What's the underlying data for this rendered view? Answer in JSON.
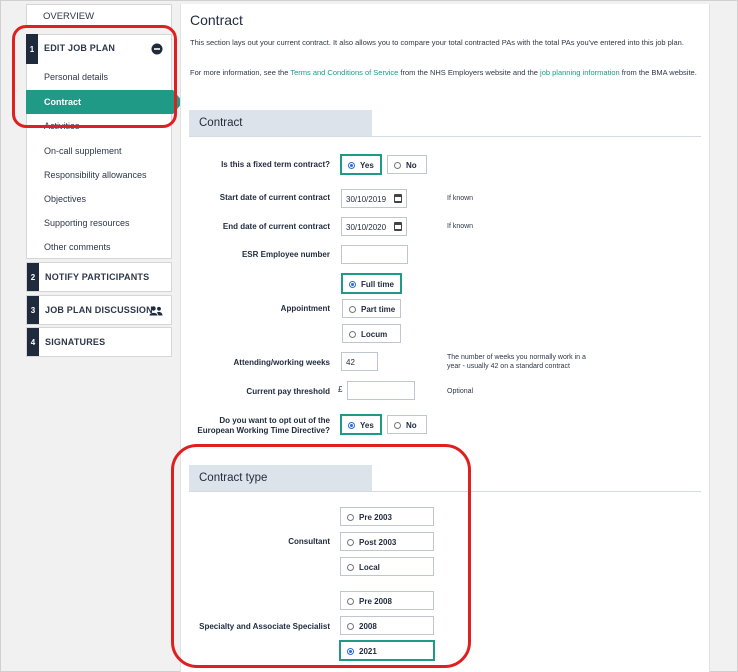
{
  "sidebar": {
    "overview": "OVERVIEW",
    "steps": [
      {
        "num": "1",
        "label": "EDIT JOB PLAN"
      },
      {
        "num": "2",
        "label": "NOTIFY PARTICIPANTS"
      },
      {
        "num": "3",
        "label": "JOB PLAN DISCUSSION"
      },
      {
        "num": "4",
        "label": "SIGNATURES"
      }
    ],
    "items": [
      "Personal details",
      "Contract",
      "Activities",
      "On-call supplement",
      "Responsibility allowances",
      "Objectives",
      "Supporting resources",
      "Other comments"
    ],
    "active_index": 1
  },
  "page": {
    "title": "Contract",
    "intro": "This section lays out your current contract. It also allows you to compare your total contracted PAs with the total PAs you've entered into this job plan.",
    "info_prefix": "For more information, see the ",
    "info_link1": "Terms and Conditions of Service",
    "info_mid": " from the NHS Employers website and the ",
    "info_link2": "job planning information",
    "info_suffix": " from the BMA website."
  },
  "contract": {
    "heading": "Contract",
    "fixed_term_label": "Is this a fixed term contract?",
    "yes": "Yes",
    "no": "No",
    "start_label": "Start date of current contract",
    "start_value": "30/10/2019",
    "end_label": "End date of current contract",
    "end_value": "30/10/2020",
    "if_known": "If known",
    "esr_label": "ESR Employee number",
    "appointment_label": "Appointment",
    "appointment_options": [
      "Full time",
      "Part time",
      "Locum"
    ],
    "weeks_label": "Attending/working weeks",
    "weeks_value": "42",
    "weeks_note": "The number of weeks you normally work in a year - usually 42 on a standard contract",
    "pay_label": "Current pay threshold",
    "pay_currency": "£",
    "optional": "Optional",
    "optout_label_1": "Do you want to opt out of the",
    "optout_label_2": "European Working Time Directive?"
  },
  "contract_type": {
    "heading": "Contract type",
    "consultant_label": "Consultant",
    "consultant_options": [
      "Pre 2003",
      "Post 2003",
      "Local"
    ],
    "sas_label": "Specialty and Associate Specialist",
    "sas_options": [
      "Pre 2008",
      "2008",
      "2021"
    ]
  },
  "icons": {
    "collapse": "minus-circle-icon",
    "participants": "people-icon",
    "calendar": "calendar-icon"
  }
}
